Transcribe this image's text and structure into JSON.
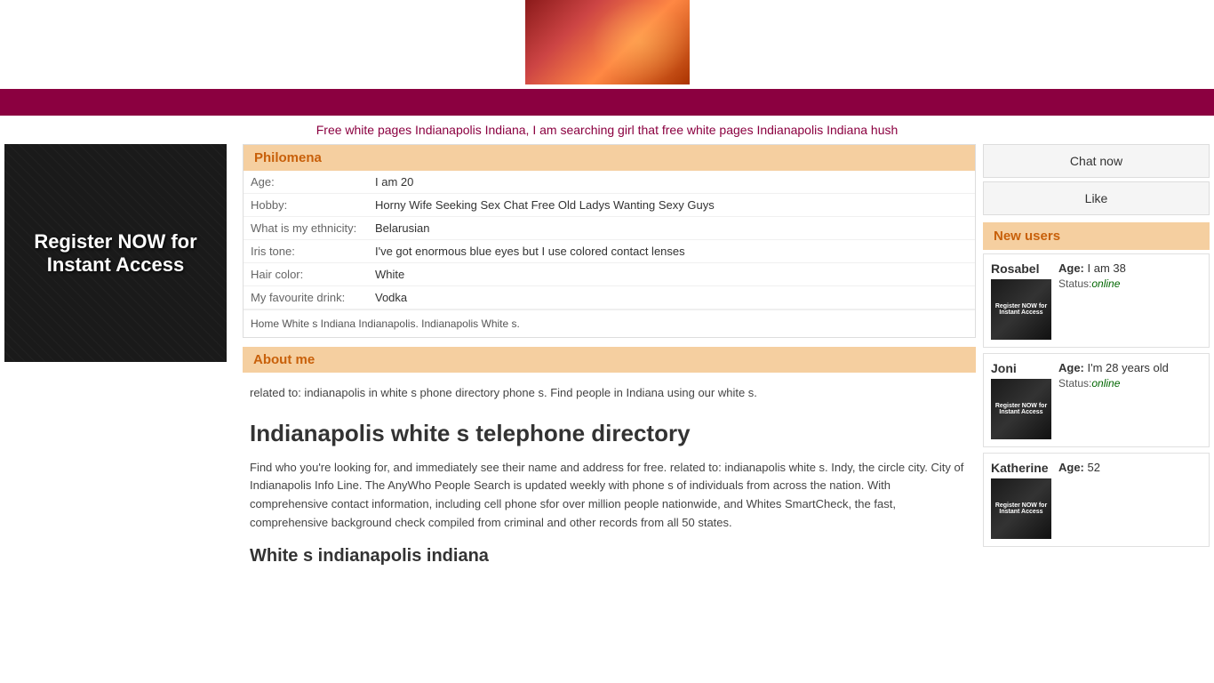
{
  "header": {
    "subtitle": "Free white pages Indianapolis Indiana, I am searching girl that free white pages Indianapolis Indiana hush"
  },
  "register_banner": {
    "text": "Register NOW for Instant Access"
  },
  "profile": {
    "name": "Philomena",
    "fields": [
      {
        "label": "Age:",
        "value": "I am 20"
      },
      {
        "label": "Hobby:",
        "value": "Horny Wife Seeking Sex Chat Free Old Ladys Wanting Sexy Guys"
      },
      {
        "label": "What is my ethnicity:",
        "value": "Belarusian"
      },
      {
        "label": "Iris tone:",
        "value": "I've got enormous blue eyes but I use colored contact lenses"
      },
      {
        "label": "Hair color:",
        "value": "White"
      },
      {
        "label": "My favourite drink:",
        "value": "Vodka"
      }
    ],
    "footer": "Home White s Indiana Indianapolis. Indianapolis White s."
  },
  "about": {
    "title": "About me",
    "body": "related to: indianapolis in white s phone directory phone s. Find people in Indiana using our white s."
  },
  "main_section": {
    "title": "Indianapolis white s telephone directory",
    "body": "Find who you're looking for, and immediately see their name and address for free. related to: indianapolis white s. Indy, the circle city. City of Indianapolis Info Line. The AnyWho People Search is updated weekly with phone s of individuals from across the nation. With comprehensive contact information, including cell phone sfor over million people nationwide, and Whites SmartCheck, the fast, comprehensive background check compiled from criminal and other records from all 50 states.",
    "subtitle": "White s indianapolis indiana"
  },
  "sidebar": {
    "chat_now_label": "Chat now",
    "like_label": "Like",
    "new_users_label": "New users",
    "users": [
      {
        "name": "Rosabel",
        "age_label": "Age:",
        "age_value": "I am 38",
        "status_label": "Status:",
        "status_value": "online",
        "thumb_text": "Register NOW for Instant Access"
      },
      {
        "name": "Joni",
        "age_label": "Age:",
        "age_value": "I'm 28 years old",
        "status_label": "Status:",
        "status_value": "online",
        "thumb_text": "Register NOW for Instant Access"
      },
      {
        "name": "Katherine",
        "age_label": "Age:",
        "age_value": "52",
        "status_label": "",
        "status_value": "",
        "thumb_text": "Register NOW for Instant Access"
      }
    ]
  }
}
